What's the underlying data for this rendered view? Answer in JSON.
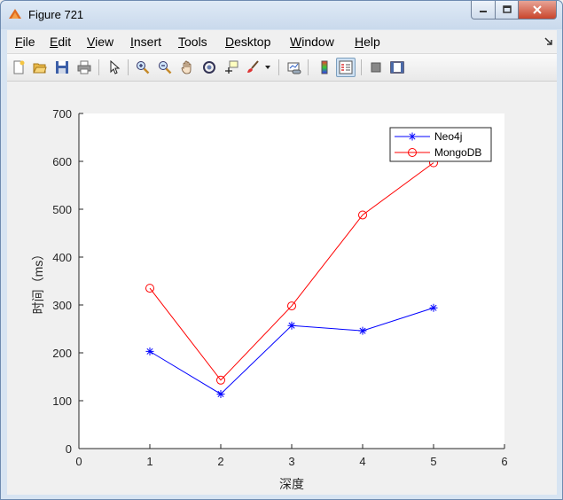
{
  "window": {
    "title": "Figure 721"
  },
  "menu": [
    {
      "label": "File",
      "key": "F",
      "rest": "ile"
    },
    {
      "label": "Edit",
      "key": "E",
      "rest": "dit"
    },
    {
      "label": "View",
      "key": "V",
      "rest": "iew"
    },
    {
      "label": "Insert",
      "key": "I",
      "rest": "nsert"
    },
    {
      "label": "Tools",
      "key": "T",
      "rest": "ools"
    },
    {
      "label": "Desktop",
      "key": "D",
      "rest": "esktop"
    },
    {
      "label": "Window",
      "key": "W",
      "rest": "indow"
    },
    {
      "label": "Help",
      "key": "H",
      "rest": "elp"
    }
  ],
  "toolbar_icons": [
    "new-figure-icon",
    "open-file-icon",
    "save-icon",
    "print-icon",
    "pointer-icon",
    "zoom-in-icon",
    "zoom-out-icon",
    "pan-icon",
    "rotate-3d-icon",
    "data-cursor-icon",
    "brush-icon",
    "link-plot-icon",
    "colorbar-icon",
    "legend-icon",
    "hide-plot-tools-icon",
    "show-plot-tools-icon"
  ],
  "chart_data": {
    "type": "line",
    "title": "",
    "xlabel": "深度",
    "ylabel": "时间（ms）",
    "xlim": [
      0,
      6
    ],
    "ylim": [
      0,
      700
    ],
    "xticks": [
      0,
      1,
      2,
      3,
      4,
      5,
      6
    ],
    "yticks": [
      0,
      100,
      200,
      300,
      400,
      500,
      600,
      700
    ],
    "x": [
      1,
      2,
      3,
      4,
      5
    ],
    "grid": false,
    "legend_position": "top-right",
    "series": [
      {
        "name": "Neo4j",
        "values": [
          203,
          114,
          257,
          246,
          294
        ],
        "color": "#0000ff",
        "marker": "asterisk"
      },
      {
        "name": "MongoDB",
        "values": [
          335,
          143,
          298,
          488,
          597
        ],
        "color": "#ff0000",
        "marker": "circle"
      }
    ]
  }
}
